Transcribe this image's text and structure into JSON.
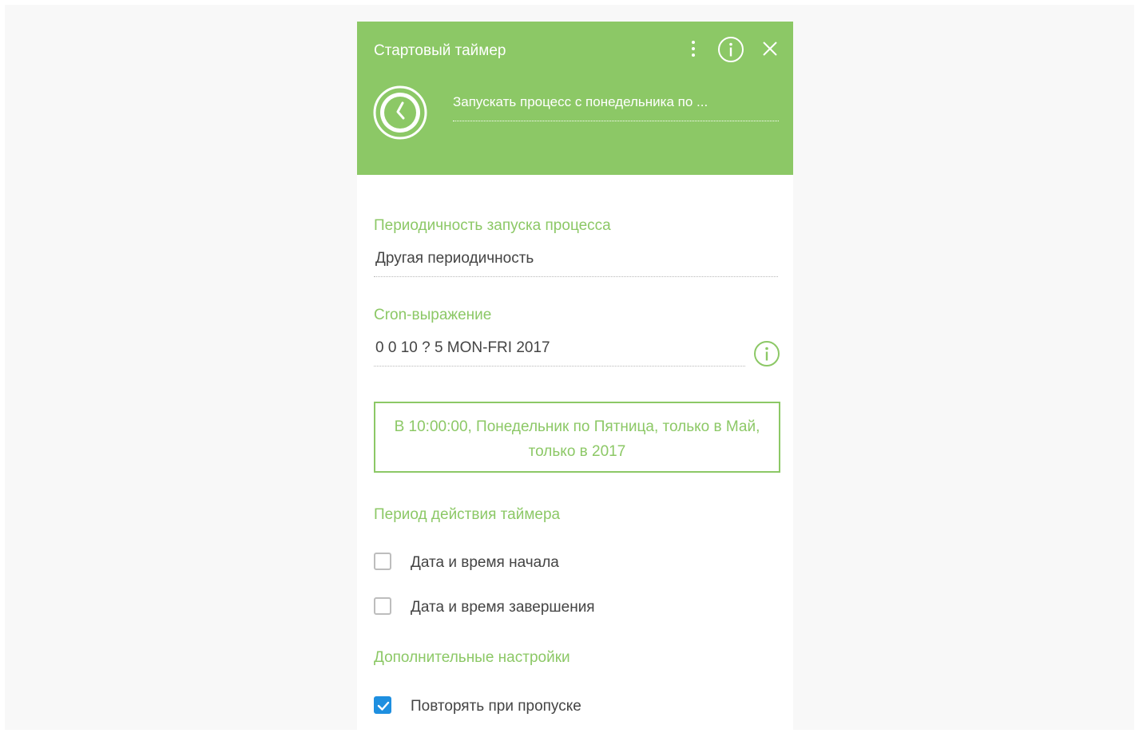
{
  "panel": {
    "title": "Стартовый таймер",
    "icons": {
      "menu": "kebab-menu-icon",
      "info": "info-icon",
      "close": "close-icon",
      "timer": "clock-icon"
    },
    "summary": "Запускать процесс с понедельника по ..."
  },
  "periodicity": {
    "label": "Периодичность запуска процесса",
    "value": "Другая периодичность"
  },
  "cron": {
    "label": "Cron-выражение",
    "value": "0 0 10 ? 5 MON-FRI 2017"
  },
  "cron_description": "В 10:00:00, Понедельник по Пятница, только в Май, только в 2017",
  "timer_period": {
    "label": "Период действия таймера",
    "start": {
      "label": "Дата и время начала",
      "checked": false
    },
    "end": {
      "label": "Дата и время завершения",
      "checked": false
    }
  },
  "additional": {
    "label": "Дополнительные настройки",
    "repeat_on_miss": {
      "label": "Повторять при пропуске",
      "checked": true
    }
  },
  "colors": {
    "accent": "#8cc866",
    "checkbox_checked": "#1e8fe0",
    "text": "#444444",
    "background": "#f8f8f8"
  }
}
